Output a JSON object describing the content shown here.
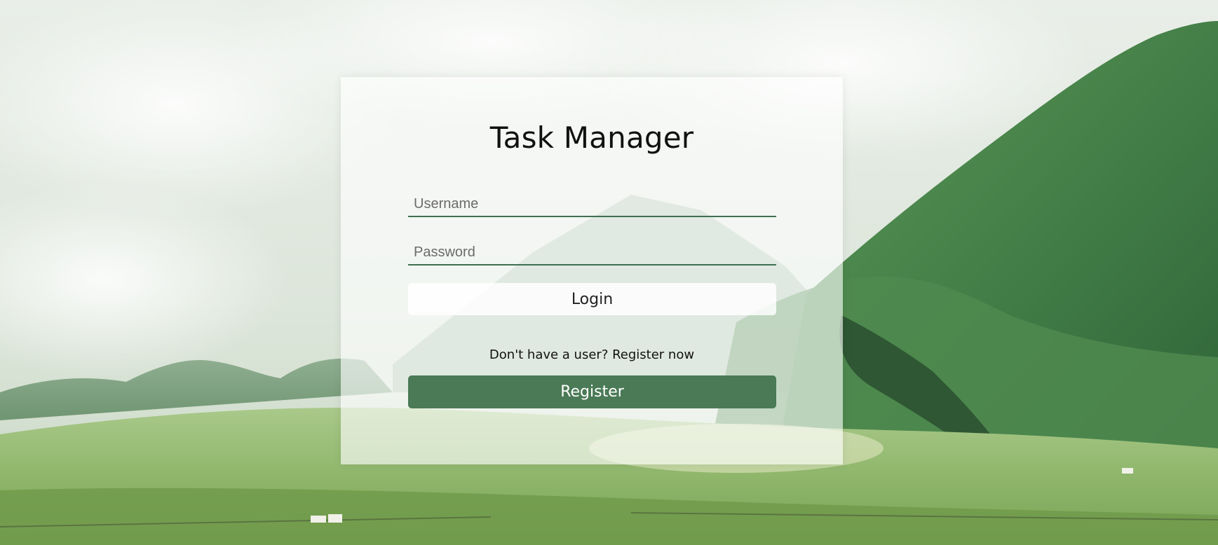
{
  "app": {
    "title": "Task Manager"
  },
  "login_form": {
    "username_placeholder": "Username",
    "password_placeholder": "Password",
    "login_label": "Login",
    "register_prompt": "Don't have a user? Register now",
    "register_label": "Register"
  },
  "colors": {
    "accent": "#4a7a56",
    "underline": "#3f6f50"
  }
}
